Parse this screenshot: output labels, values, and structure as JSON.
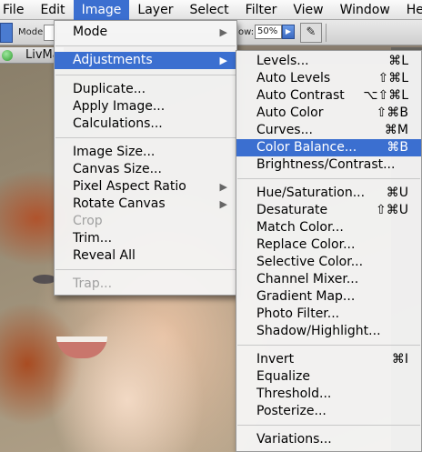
{
  "menubar": {
    "items": [
      "File",
      "Edit",
      "Image",
      "Layer",
      "Select",
      "Filter",
      "View",
      "Window",
      "Help"
    ],
    "active": "Image"
  },
  "options_bar": {
    "mode_label": "Mode:",
    "flow_label": "ow:",
    "flow_value": "50%"
  },
  "document": {
    "title": "LivMa"
  },
  "image_menu": {
    "mode": "Mode",
    "adjustments": "Adjustments",
    "duplicate": "Duplicate...",
    "apply_image": "Apply Image...",
    "calculations": "Calculations...",
    "image_size": "Image Size...",
    "canvas_size": "Canvas Size...",
    "pixel_aspect_ratio": "Pixel Aspect Ratio",
    "rotate_canvas": "Rotate Canvas",
    "crop": "Crop",
    "trim": "Trim...",
    "reveal_all": "Reveal All",
    "trap": "Trap..."
  },
  "adjustments_menu": {
    "levels": {
      "label": "Levels...",
      "shortcut": "⌘L"
    },
    "auto_levels": {
      "label": "Auto Levels",
      "shortcut": "⇧⌘L"
    },
    "auto_contrast": {
      "label": "Auto Contrast",
      "shortcut": "⌥⇧⌘L"
    },
    "auto_color": {
      "label": "Auto Color",
      "shortcut": "⇧⌘B"
    },
    "curves": {
      "label": "Curves...",
      "shortcut": "⌘M"
    },
    "color_balance": {
      "label": "Color Balance...",
      "shortcut": "⌘B"
    },
    "brightness_contrast": {
      "label": "Brightness/Contrast..."
    },
    "hue_saturation": {
      "label": "Hue/Saturation...",
      "shortcut": "⌘U"
    },
    "desaturate": {
      "label": "Desaturate",
      "shortcut": "⇧⌘U"
    },
    "match_color": {
      "label": "Match Color..."
    },
    "replace_color": {
      "label": "Replace Color..."
    },
    "selective_color": {
      "label": "Selective Color..."
    },
    "channel_mixer": {
      "label": "Channel Mixer..."
    },
    "gradient_map": {
      "label": "Gradient Map..."
    },
    "photo_filter": {
      "label": "Photo Filter..."
    },
    "shadow_highlight": {
      "label": "Shadow/Highlight..."
    },
    "invert": {
      "label": "Invert",
      "shortcut": "⌘I"
    },
    "equalize": {
      "label": "Equalize"
    },
    "threshold": {
      "label": "Threshold..."
    },
    "posterize": {
      "label": "Posterize..."
    },
    "variations": {
      "label": "Variations..."
    }
  },
  "colors": {
    "highlight": "#3b6fd0"
  }
}
